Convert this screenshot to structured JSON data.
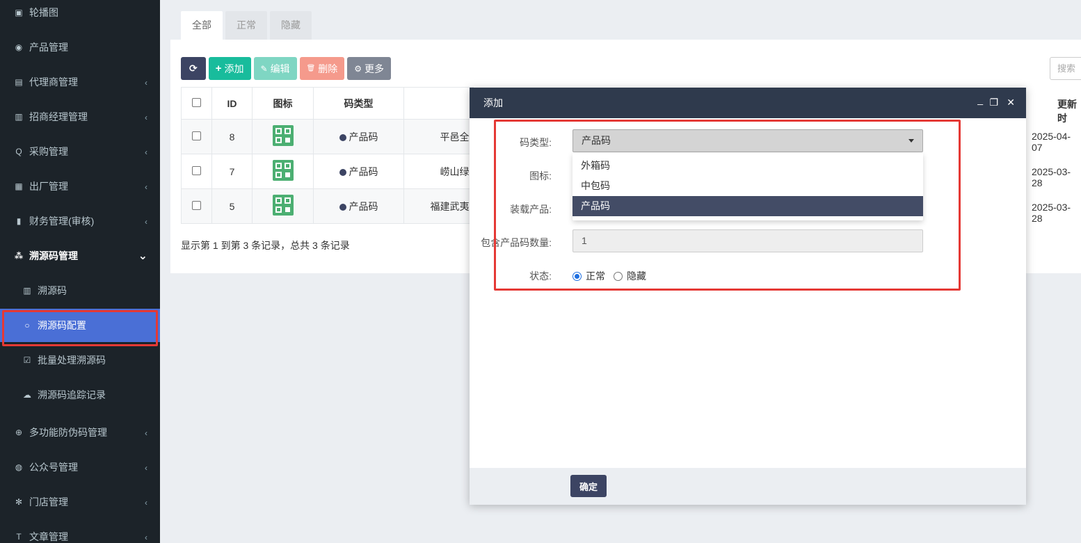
{
  "sidebar": {
    "items": [
      {
        "label": "轮播图",
        "icon": "image-icon",
        "glyph": "▣",
        "arrow": ""
      },
      {
        "label": "产品管理",
        "icon": "globe-icon",
        "glyph": "◉",
        "arrow": ""
      },
      {
        "label": "代理商管理",
        "icon": "id-card-icon",
        "glyph": "▤",
        "arrow": "‹"
      },
      {
        "label": "招商经理管理",
        "icon": "portrait-icon",
        "glyph": "▥",
        "arrow": "‹"
      },
      {
        "label": "采购管理",
        "icon": "q-icon",
        "glyph": "Q",
        "arrow": "‹"
      },
      {
        "label": "出厂管理",
        "icon": "train-icon",
        "glyph": "▦",
        "arrow": "‹"
      },
      {
        "label": "财务管理(审核)",
        "icon": "bank-icon",
        "glyph": "▮",
        "arrow": "‹"
      },
      {
        "label": "溯源码管理",
        "icon": "cubes-icon",
        "glyph": "⁂",
        "arrow": "⌄"
      },
      {
        "label": "溯源码",
        "icon": "barcode-icon",
        "glyph": "▥",
        "arrow": ""
      },
      {
        "label": "溯源码配置",
        "icon": "circle-o-icon",
        "glyph": "○",
        "arrow": ""
      },
      {
        "label": "批量处理溯源码",
        "icon": "check-square-icon",
        "glyph": "☑",
        "arrow": ""
      },
      {
        "label": "溯源码追踪记录",
        "icon": "cloud-icon",
        "glyph": "☁",
        "arrow": ""
      },
      {
        "label": "多功能防伪码管理",
        "icon": "upload-circle-icon",
        "glyph": "⊕",
        "arrow": "‹"
      },
      {
        "label": "公众号管理",
        "icon": "wechat-icon",
        "glyph": "◍",
        "arrow": "‹"
      },
      {
        "label": "门店管理",
        "icon": "asterisk-icon",
        "glyph": "✻",
        "arrow": "‹"
      },
      {
        "label": "文章管理",
        "icon": "text-icon",
        "glyph": "T",
        "arrow": "‹"
      }
    ]
  },
  "tabs": [
    "全部",
    "正常",
    "隐藏"
  ],
  "toolbar": {
    "refresh_glyph": "⟳",
    "add": "添加",
    "add_glyph": "+",
    "edit": "编辑",
    "edit_glyph": "✎",
    "delete": "删除",
    "delete_glyph": "🗑",
    "more": "更多",
    "more_glyph": "⚙"
  },
  "search": {
    "placeholder": "搜索"
  },
  "table": {
    "headers": [
      "ID",
      "图标",
      "码类型"
    ],
    "rows": [
      {
        "id": "8",
        "type": "产品码",
        "name": "平邑全",
        "date": "2025-04-07"
      },
      {
        "id": "7",
        "type": "产品码",
        "name": "崂山绿",
        "date": "2025-03-28"
      },
      {
        "id": "5",
        "type": "产品码",
        "name": "福建武夷",
        "date": "2025-03-28"
      }
    ],
    "right_header": "更新时"
  },
  "pager": {
    "text": "显示第 1 到第 3 条记录，总共 3 条记录"
  },
  "modal": {
    "title": "添加",
    "minimize": "_",
    "maximize": "❐",
    "close": "✕",
    "fields": {
      "code_type_label": "码类型:",
      "code_type_value": "产品码",
      "icon_label": "图标:",
      "product_label": "装载产品:",
      "count_label": "包含产品码数量:",
      "count_value": "1",
      "status_label": "状态:",
      "status_options": [
        "正常",
        "隐藏"
      ],
      "status_selected": "正常"
    },
    "dropdown_options": [
      "外箱码",
      "中包码",
      "产品码"
    ],
    "dropdown_selected": "产品码",
    "ok_button": "确定"
  }
}
